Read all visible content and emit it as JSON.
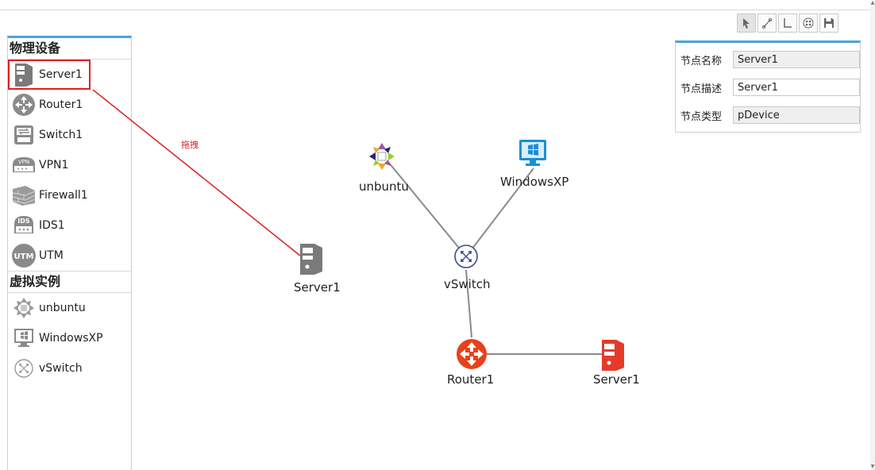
{
  "palette": {
    "physical_title": "物理设备",
    "physical_items": [
      {
        "label": "Server1",
        "icon": "server-icon"
      },
      {
        "label": "Router1",
        "icon": "router-icon"
      },
      {
        "label": "Switch1",
        "icon": "switch-icon"
      },
      {
        "label": "VPN1",
        "icon": "vpn-icon"
      },
      {
        "label": "Firewall1",
        "icon": "firewall-icon"
      },
      {
        "label": "IDS1",
        "icon": "ids-icon"
      },
      {
        "label": "UTM",
        "icon": "utm-icon"
      }
    ],
    "virtual_title": "虚拟实例",
    "virtual_items": [
      {
        "label": "unbuntu",
        "icon": "centos-icon"
      },
      {
        "label": "WindowsXP",
        "icon": "windows-icon"
      },
      {
        "label": "vSwitch",
        "icon": "vswitch-icon"
      }
    ]
  },
  "canvas": {
    "drag_annotation": "拖拽",
    "nodes": {
      "dragged_server": "Server1",
      "ubuntu": "unbuntu",
      "windowsxp": "WindowsXP",
      "vswitch": "vSwitch",
      "router": "Router1",
      "server": "Server1"
    }
  },
  "properties": {
    "name_label": "节点名称",
    "name_value": "Server1",
    "desc_label": "节点描述",
    "desc_value": "Server1",
    "type_label": "节点类型",
    "type_value": "pDevice"
  },
  "colors": {
    "accent": "#4aa3df",
    "selection": "#e02020",
    "router": "#e8421b",
    "server_red": "#e53a2a",
    "link": "#8a8a8a"
  }
}
